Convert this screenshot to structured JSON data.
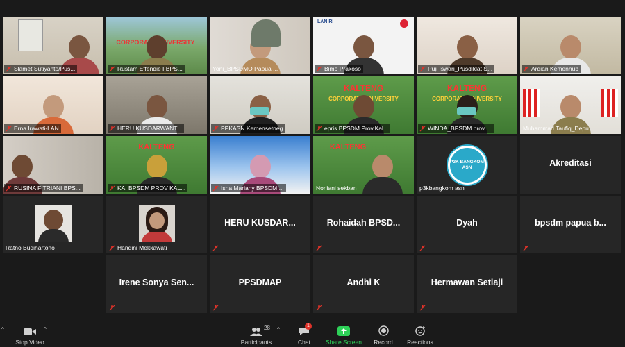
{
  "tiles": [
    {
      "name": "Slamet Sutiyanto/Pus...",
      "muted": true
    },
    {
      "name": "Rustam Effendie I BPS...",
      "muted": true
    },
    {
      "name": "Yoni_BPSDMO Papua ...",
      "muted": false
    },
    {
      "name": "Bimo Prakoso",
      "muted": true
    },
    {
      "name": "Puji Iswari_Pusdiklat S...",
      "muted": true
    },
    {
      "name": "Ardian Kemenhub",
      "muted": true
    },
    {
      "name": "Erna Irawati-LAN",
      "muted": true
    },
    {
      "name": "HERU KUSDARWANT...",
      "muted": true
    },
    {
      "name": "PPKASN Kemensetneg",
      "muted": true
    },
    {
      "name": "epris BPSDM Prov.Kal...",
      "muted": true
    },
    {
      "name": "WINDA_BPSDM prov. ...",
      "muted": true
    },
    {
      "name": "Muhammad Taufiq_Depu...",
      "muted": false
    },
    {
      "name": "RUSINA FITRIANI BPS...",
      "muted": true
    },
    {
      "name": "KA. BPSDM PROV KAL...",
      "muted": true
    },
    {
      "name": "Isna Mariany BPSDM ...",
      "muted": true
    },
    {
      "name": "Norliani sekban",
      "muted": false
    },
    {
      "name": "p3kbangkom asn",
      "muted": false
    },
    {
      "big": "Akreditasi"
    },
    {
      "name": "Ratno Budihartono",
      "muted": false
    },
    {
      "name": "Handini Mekkawati",
      "muted": true
    },
    {
      "big": "HERU  KUSDAR...",
      "muted": true
    },
    {
      "big": "Rohaidah  BPSD...",
      "muted": true
    },
    {
      "big": "Dyah",
      "muted": true
    },
    {
      "big": "bpsdm papua b...",
      "muted": true
    },
    {
      "big": "Irene Sonya Sen...",
      "muted": true
    },
    {
      "big": "PPSDMAP",
      "muted": true
    },
    {
      "big": "Andhi K",
      "muted": true
    },
    {
      "big": "Hermawan Setiaji",
      "muted": true
    }
  ],
  "logo_text": "P3K BANGKOM ASN",
  "toolbar": {
    "stop_video": "Stop Video",
    "participants": "Participants",
    "participant_count": "28",
    "chat": "Chat",
    "chat_badge": "1",
    "share_screen": "Share Screen",
    "record": "Record",
    "reactions": "Reactions"
  },
  "colors": {
    "share_green": "#2ed158",
    "active_border": "#d6e044",
    "muted_red": "#e0332a"
  }
}
